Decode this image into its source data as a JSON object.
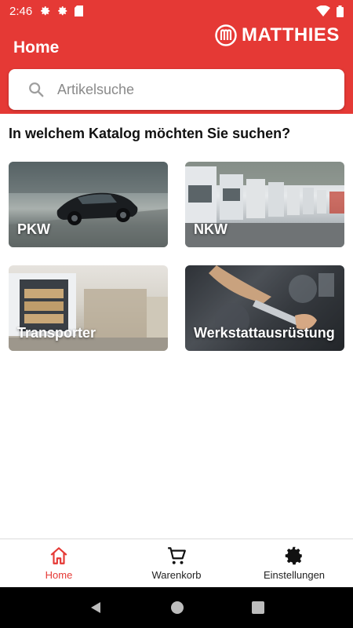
{
  "status_bar": {
    "time": "2:46",
    "left_icons": [
      "gear-icon",
      "gear-icon",
      "sd-card-icon"
    ],
    "right_icons": [
      "wifi-icon",
      "battery-icon"
    ]
  },
  "app_bar": {
    "title": "Home",
    "brand": "MATTHIES",
    "background_color": "#e53935"
  },
  "search": {
    "placeholder": "Artikelsuche",
    "value": ""
  },
  "main": {
    "question": "In welchem Katalog möchten Sie suchen?",
    "catalogs": [
      {
        "label": "PKW",
        "image": "sports-car-photo"
      },
      {
        "label": "NKW",
        "image": "truck-fleet-photo"
      },
      {
        "label": "Transporter",
        "image": "van-pallets-photo"
      },
      {
        "label": "Werkstattausrüstung",
        "image": "wrench-engine-photo"
      }
    ]
  },
  "bottom_nav": {
    "items": [
      {
        "label": "Home",
        "icon": "home-icon",
        "active": true
      },
      {
        "label": "Warenkorb",
        "icon": "cart-icon",
        "active": false
      },
      {
        "label": "Einstellungen",
        "icon": "gear-icon",
        "active": false
      }
    ],
    "active_color": "#e53935"
  },
  "system_nav": {
    "buttons": [
      "back-icon",
      "home-circle-icon",
      "recents-icon"
    ]
  }
}
